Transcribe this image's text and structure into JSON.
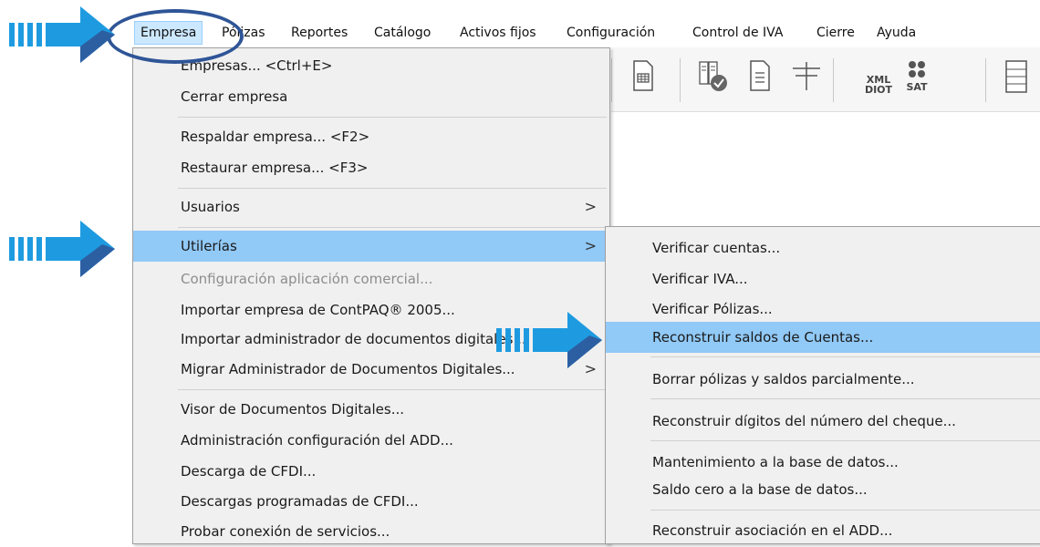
{
  "menubar": {
    "items": [
      "Empresa",
      "Pólizas",
      "Reportes",
      "Catálogo",
      "Activos fijos",
      "Configuración",
      "Control de IVA",
      "Cierre",
      "Ayuda"
    ],
    "active": "Empresa"
  },
  "toolbar": {
    "icons": [
      "table-icon",
      "documents-check-icon",
      "list-document-icon",
      "ledger-t-icon",
      "xml-diot-icon",
      "sat-icon",
      "ledger-icon"
    ],
    "xml_label": "XML",
    "diot_label": "DIOT",
    "sat_label": "SAT"
  },
  "empresa_menu": {
    "items": [
      {
        "label": "Empresas... <Ctrl+E>"
      },
      {
        "label": "Cerrar empresa"
      },
      {
        "label": "Respaldar empresa... <F2>"
      },
      {
        "label": "Restaurar empresa... <F3>"
      },
      {
        "label": "Usuarios",
        "submenu": true
      },
      {
        "label": "Utilerías",
        "submenu": true,
        "highlighted": true
      },
      {
        "label": "Configuración aplicación comercial...",
        "disabled": true
      },
      {
        "label": "Importar empresa de ContPAQ® 2005..."
      },
      {
        "label": "Importar administrador de documentos digitales..."
      },
      {
        "label": "Migrar Administrador de Documentos Digitales...",
        "submenu": true
      },
      {
        "label": "Visor de Documentos Digitales..."
      },
      {
        "label": "Administración configuración del ADD..."
      },
      {
        "label": "Descarga de CFDI..."
      },
      {
        "label": "Descargas programadas de CFDI..."
      },
      {
        "label": "Probar conexión de servicios..."
      }
    ],
    "arrow": ">"
  },
  "utilerias_submenu": {
    "items": [
      {
        "label": "Verificar cuentas..."
      },
      {
        "label": "Verificar IVA..."
      },
      {
        "label": "Verificar Pólizas..."
      },
      {
        "label": "Reconstruir saldos de Cuentas...",
        "highlighted": true
      },
      {
        "label": "Borrar pólizas y saldos parcialmente..."
      },
      {
        "label": "Reconstruir dígitos del número del cheque..."
      },
      {
        "label": "Mantenimiento a la base de datos..."
      },
      {
        "label": "Saldo cero a la base de datos..."
      },
      {
        "label": "Reconstruir asociación en el ADD..."
      }
    ]
  },
  "colors": {
    "highlight": "#91c9f7",
    "menu_bg": "#f0f0f0",
    "callout_blue": "#1e9be0",
    "callout_dark": "#2f5597"
  }
}
